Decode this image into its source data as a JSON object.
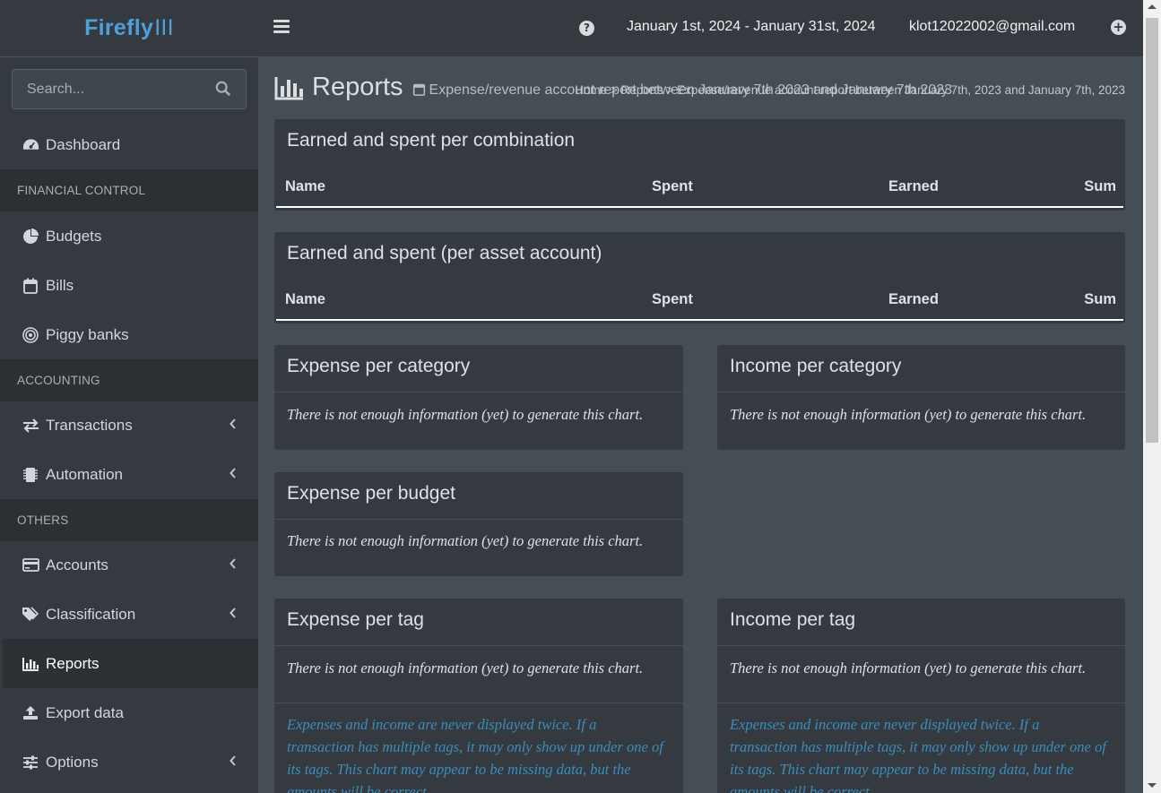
{
  "brand": {
    "name": "Firefly",
    "suffix": "III"
  },
  "topbar": {
    "date_range": "January 1st, 2024 - January 31st, 2024",
    "user_email": "klot12022002@gmail.com"
  },
  "sidebar": {
    "search_placeholder": "Search...",
    "items": [
      {
        "label": "Dashboard"
      },
      {
        "section": "FINANCIAL CONTROL"
      },
      {
        "label": "Budgets"
      },
      {
        "label": "Bills"
      },
      {
        "label": "Piggy banks"
      },
      {
        "section": "ACCOUNTING"
      },
      {
        "label": "Transactions"
      },
      {
        "label": "Automation"
      },
      {
        "section": "OTHERS"
      },
      {
        "label": "Accounts"
      },
      {
        "label": "Classification"
      },
      {
        "label": "Reports"
      },
      {
        "label": "Export data"
      },
      {
        "label": "Options"
      }
    ]
  },
  "page": {
    "title": "Reports",
    "subtitle": "Expense/revenue account report between January 7th 2023 and January 7th 2023",
    "breadcrumb": "Home > Reports > Expense/revenue account report between January 7th, 2023 and January 7th, 2023"
  },
  "cards": {
    "combination": {
      "title": "Earned and spent per combination",
      "cols": [
        "Name",
        "Spent",
        "Earned",
        "Sum"
      ]
    },
    "asset": {
      "title": "Earned and spent (per asset account)",
      "cols": [
        "Name",
        "Spent",
        "Earned",
        "Sum"
      ]
    },
    "expense_category": {
      "title": "Expense per category",
      "msg": "There is not enough information (yet) to generate this chart."
    },
    "income_category": {
      "title": "Income per category",
      "msg": "There is not enough information (yet) to generate this chart."
    },
    "expense_budget": {
      "title": "Expense per budget",
      "msg": "There is not enough information (yet) to generate this chart."
    },
    "expense_tag": {
      "title": "Expense per tag",
      "msg": "There is not enough information (yet) to generate this chart.",
      "note": "Expenses and income are never displayed twice. If a transaction has multiple tags, it may only show up under one of its tags. This chart may appear to be missing data, but the amounts will be correct."
    },
    "income_tag": {
      "title": "Income per tag",
      "msg": "There is not enough information (yet) to generate this chart.",
      "note": "Expenses and income are never displayed twice. If a transaction has multiple tags, it may only show up under one of its tags. This chart may appear to be missing data, but the amounts will be correct."
    }
  },
  "colors": {
    "brand": "#4f9fd9",
    "note": "#3c8dbc",
    "bg_main": "#454d55",
    "bg_card": "#343a40"
  }
}
